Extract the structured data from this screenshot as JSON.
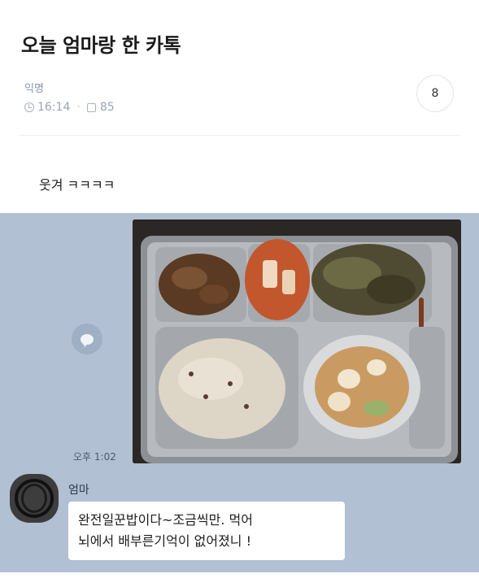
{
  "post": {
    "title": "오늘 엄마랑 한 카톡",
    "author": "익명",
    "time": "16:14",
    "views": "85",
    "comment_count": "8",
    "body_text": "웃겨 ㅋㅋㅋㅋ"
  },
  "chat": {
    "photo_time": "오후 1:02",
    "sender_name": "엄마",
    "message_lines": [
      "완전일꾼밥이다~조금씩만. 먹어",
      "뇌에서 배부른기억이 없어졌니 !"
    ]
  },
  "colors": {
    "chat_background": "#b1c0d3",
    "bubble_background": "#ffffff",
    "meta_text": "#9aa3b3"
  },
  "icons": {
    "clock": "clock-icon",
    "views": "view-count-icon",
    "share": "chat-bubble-icon"
  }
}
